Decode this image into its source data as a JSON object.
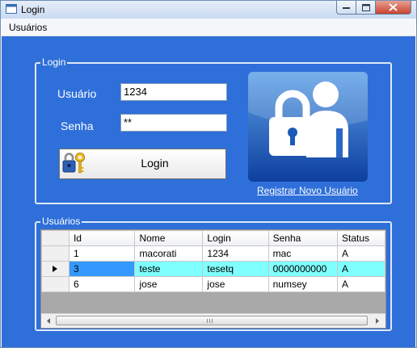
{
  "window": {
    "title": "Login",
    "menu": [
      "Usuários"
    ]
  },
  "login_group": {
    "legend": "Login",
    "usuario_label": "Usuário",
    "usuario_value": "1234",
    "senha_label": "Senha",
    "senha_value": "**",
    "login_button": "Login",
    "register_link": "Registrar Novo Usuário"
  },
  "users_group": {
    "legend": "Usuários",
    "columns": [
      "Id",
      "Nome",
      "Login",
      "Senha",
      "Status"
    ],
    "rows": [
      [
        "1",
        "macorati",
        "1234",
        "mac",
        "A"
      ],
      [
        "3",
        "teste",
        "tesetq",
        "0000000000",
        "A"
      ],
      [
        "6",
        "jose",
        "jose",
        "numsey",
        "A"
      ]
    ],
    "selected_row": 1
  },
  "icons": {
    "app": "app-form-icon",
    "key": "key-lock-icon",
    "user_lock": "user-padlock-icon"
  },
  "colors": {
    "form_background": "#2f6fd9",
    "selected_row": "#80ffff",
    "current_cell": "#3399ff"
  }
}
